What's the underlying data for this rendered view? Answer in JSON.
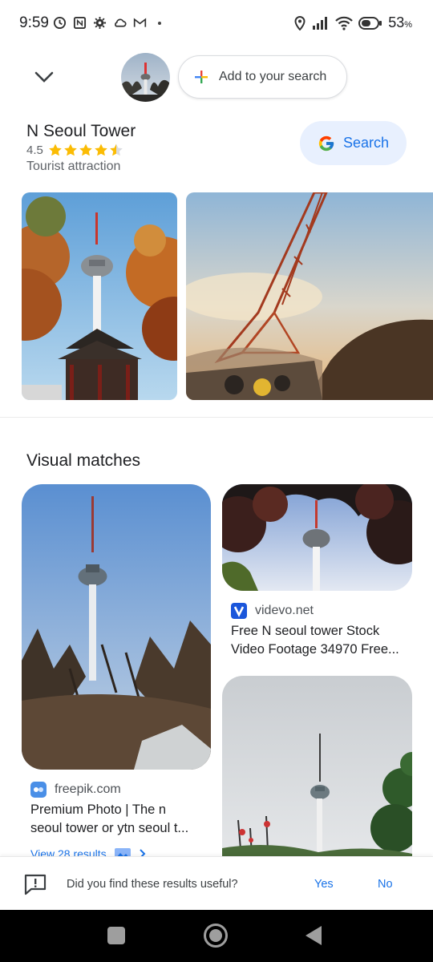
{
  "status_bar": {
    "time": "9:59",
    "battery_percent": "53",
    "battery_unit": "%",
    "icons": [
      "alarm-icon",
      "nfc-icon",
      "settings-icon",
      "cloud-icon",
      "gmail-icon",
      "notification-dot",
      "location-icon",
      "signal-icon",
      "wifi-icon",
      "battery-icon"
    ]
  },
  "header": {
    "collapse_icon": "chevron-down-icon",
    "add_to_search_label": "Add to your search"
  },
  "knowledge": {
    "title": "N Seoul Tower",
    "rating": "4.5",
    "rating_value": 4.5,
    "rating_max": 5,
    "type": "Tourist attraction",
    "search_button_label": "Search"
  },
  "visual_matches": {
    "heading": "Visual matches",
    "results": [
      {
        "site": "freepik.com",
        "title_line1": "Premium Photo | The n",
        "title_line2": "seoul tower or ytn seoul t...",
        "view_results": "View 28 results"
      },
      {
        "site": "videvo.net",
        "title_line1": "Free N seoul tower Stock",
        "title_line2": "Video Footage 34970 Free..."
      }
    ]
  },
  "feedback": {
    "question": "Did you find these results useful?",
    "yes_label": "Yes",
    "no_label": "No"
  },
  "colors": {
    "accent_blue": "#1a73e8",
    "search_chip_bg": "#e8f0fe",
    "star_yellow": "#fbbc04"
  }
}
